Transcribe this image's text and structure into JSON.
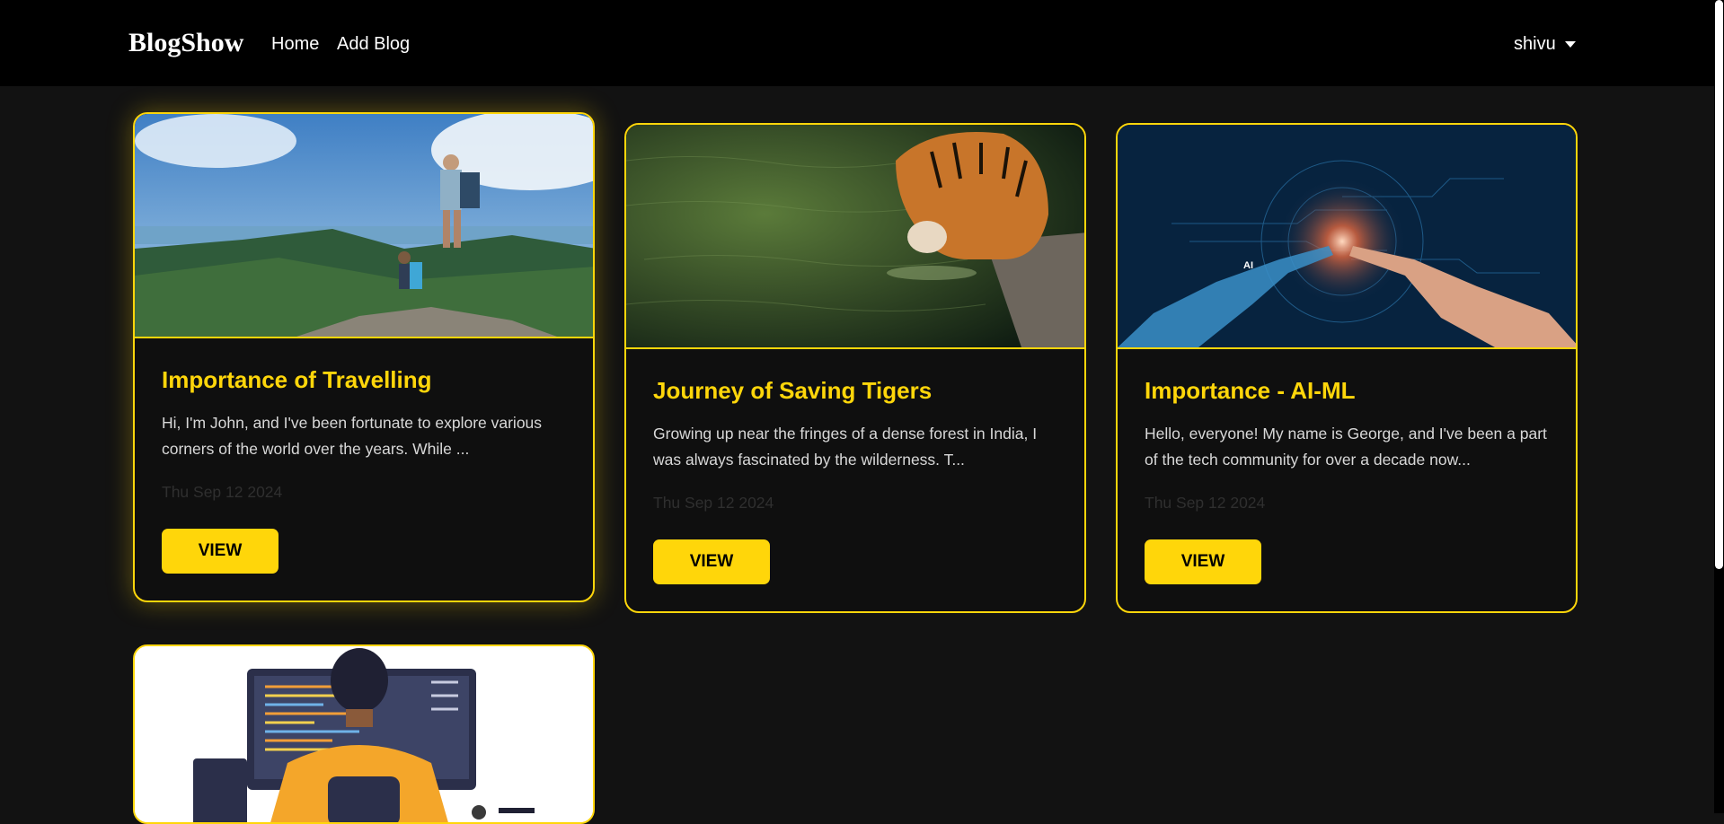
{
  "nav": {
    "brand": "BlogShow",
    "links": [
      "Home",
      "Add Blog"
    ],
    "user": "shivu"
  },
  "theme": {
    "accent": "#ffd60a",
    "background": "#121212",
    "navbar": "#000000"
  },
  "posts": [
    {
      "title": "Importance of Travelling",
      "excerpt": "Hi, I'm John, and I've been fortunate to explore various corners of the world over the years. While ...",
      "date": "Thu Sep 12 2024",
      "button": "VIEW",
      "image": "travel-hikers-photo"
    },
    {
      "title": "Journey of Saving Tigers",
      "excerpt": "Growing up near the fringes of a dense forest in India, I was always fascinated by the wilderness. T...",
      "date": "Thu Sep 12 2024",
      "button": "VIEW",
      "image": "tiger-drinking-photo"
    },
    {
      "title": "Importance - AI-ML",
      "excerpt": "Hello, everyone! My name is George, and I've been a part of the tech community for over a decade now...",
      "date": "Thu Sep 12 2024",
      "button": "VIEW",
      "image": "ai-hand-touch-photo",
      "image_label": "AI"
    },
    {
      "image": "programmer-illustration"
    }
  ]
}
